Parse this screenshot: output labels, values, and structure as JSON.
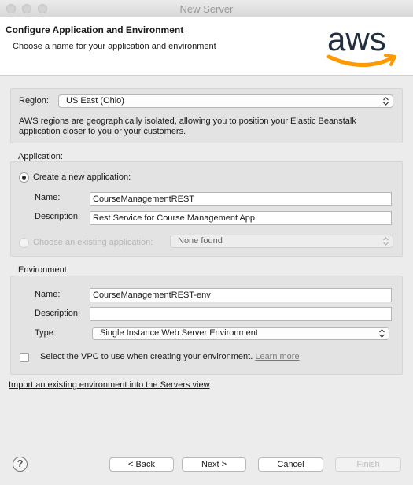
{
  "window": {
    "title": "New Server"
  },
  "header": {
    "title": "Configure Application and Environment",
    "subtitle": "Choose a name for your application and environment",
    "logo_text": "aws"
  },
  "region": {
    "label": "Region:",
    "value": "US East (Ohio)",
    "description_line1": "AWS regions are geographically isolated, allowing you to position your Elastic Beanstalk",
    "description_line2": "application closer to you or your customers."
  },
  "application": {
    "section_label": "Application:",
    "create_new_label": "Create a new application:",
    "create_new_selected": true,
    "name_label": "Name:",
    "name_value": "CourseManagementREST",
    "description_label": "Description:",
    "description_value": "Rest Service for Course Management App",
    "choose_existing_label": "Choose an existing application:",
    "existing_value": "None found"
  },
  "environment": {
    "section_label": "Environment:",
    "name_label": "Name:",
    "name_value": "CourseManagementREST-env",
    "description_label": "Description:",
    "description_value": "",
    "type_label": "Type:",
    "type_value": "Single Instance Web Server Environment",
    "vpc_label": "Select the VPC to use when creating your environment.",
    "vpc_checked": false,
    "learn_more": "Learn more"
  },
  "import_link": "Import an existing environment into the Servers view",
  "buttons": {
    "help": "?",
    "back": "< Back",
    "next": "Next >",
    "cancel": "Cancel",
    "finish": "Finish"
  },
  "colors": {
    "aws_text": "#232f3e",
    "aws_smile": "#ff9900"
  }
}
